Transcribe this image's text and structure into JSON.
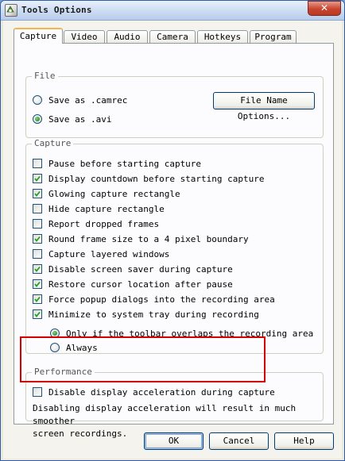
{
  "window": {
    "title": "Tools Options",
    "close_symbol": "✕"
  },
  "tabs": [
    {
      "label": "Capture",
      "active": true
    },
    {
      "label": "Video"
    },
    {
      "label": "Audio"
    },
    {
      "label": "Camera"
    },
    {
      "label": "Hotkeys"
    },
    {
      "label": "Program"
    }
  ],
  "file_group": {
    "label": "File",
    "options": [
      {
        "label": "Save as .camrec",
        "selected": false
      },
      {
        "label": "Save as .avi",
        "selected": true
      }
    ],
    "file_name_button": "File Name Options..."
  },
  "capture_group": {
    "label": "Capture",
    "checkboxes": [
      {
        "label": "Pause before starting capture",
        "checked": false
      },
      {
        "label": "Display countdown before starting capture",
        "checked": true
      },
      {
        "label": "Glowing capture rectangle",
        "checked": true
      },
      {
        "label": "Hide capture rectangle",
        "checked": false
      },
      {
        "label": "Report dropped frames",
        "checked": false
      },
      {
        "label": "Round frame size to a 4 pixel boundary",
        "checked": true
      },
      {
        "label": "Capture layered windows",
        "checked": false
      },
      {
        "label": "Disable screen saver during capture",
        "checked": true
      },
      {
        "label": "Restore cursor location after pause",
        "checked": true
      },
      {
        "label": "Force popup dialogs into the recording area",
        "checked": true
      },
      {
        "label": "Minimize to system tray during recording",
        "checked": true
      }
    ],
    "minimize_options": [
      {
        "label": "Only if the toolbar overlaps the recording area",
        "selected": true
      },
      {
        "label": "Always",
        "selected": false
      }
    ]
  },
  "performance_group": {
    "label": "Performance",
    "checkbox": {
      "label": "Disable display acceleration during capture",
      "checked": false
    },
    "note_line1": "Disabling display acceleration will result in much smoother",
    "note_line2": "screen recordings."
  },
  "buttons": {
    "ok": "OK",
    "cancel": "Cancel",
    "help": "Help"
  },
  "colors": {
    "highlight": "#d40000",
    "active_tab_accent": "#f5b54b",
    "titlebar": "#c9daf2"
  },
  "icons": {
    "title": "app-icon",
    "checkmark": "checkmark-icon",
    "close": "close-icon"
  }
}
